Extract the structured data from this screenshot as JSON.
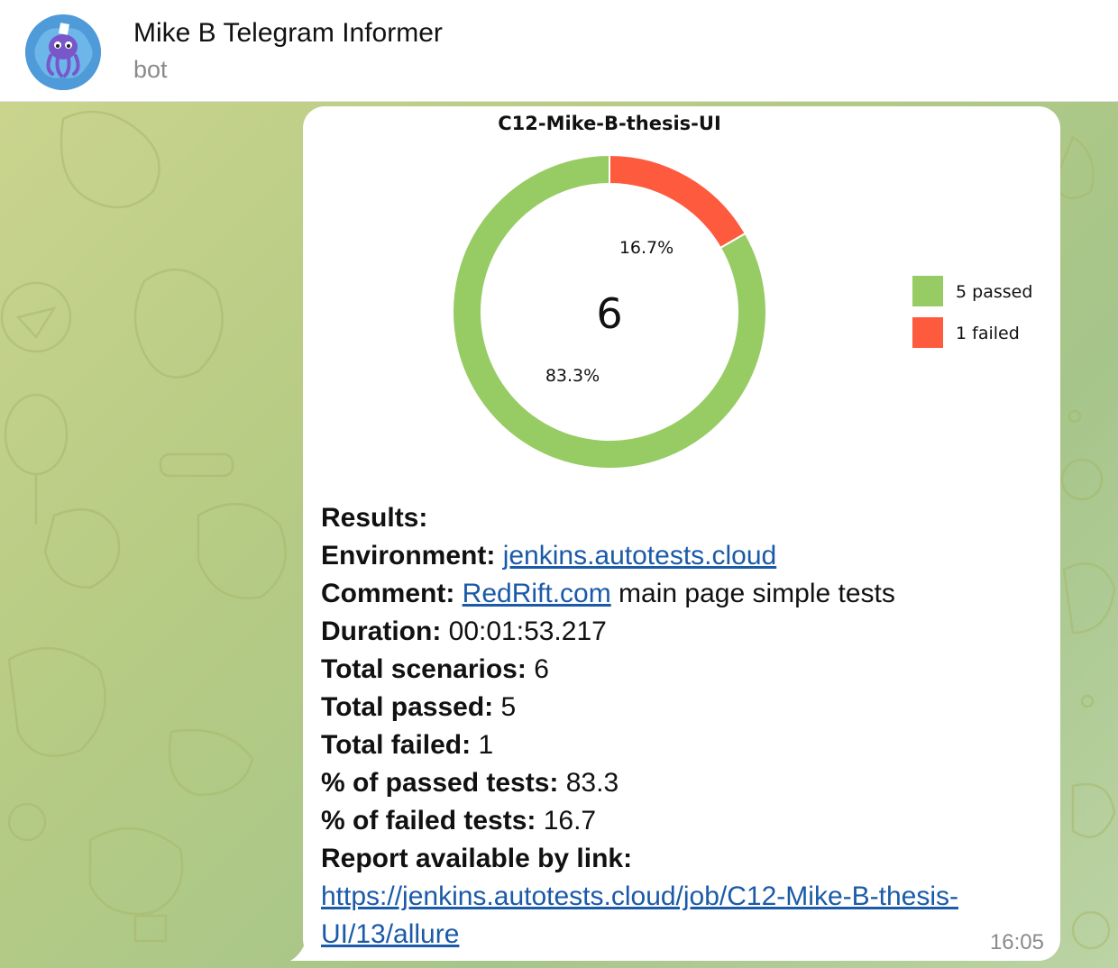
{
  "header": {
    "title": "Mike B Telegram Informer",
    "subtitle": "bot",
    "avatar_icon": "octopus-bot-icon"
  },
  "message": {
    "chart_data": {
      "type": "pie",
      "title": "C12-Mike-B-thesis-UI",
      "center_label": "6",
      "slices": [
        {
          "label": "5 passed",
          "value": 5,
          "percent_label": "83.3%",
          "color": "#97cc64"
        },
        {
          "label": "1 failed",
          "value": 1,
          "percent_label": "16.7%",
          "color": "#fd5a3e"
        }
      ],
      "legend_position": "right"
    },
    "results_label": "Results:",
    "environment_label": "Environment: ",
    "environment_link": "jenkins.autotests.cloud",
    "comment_label": "Comment: ",
    "comment_link": "RedRift.com",
    "comment_text": " main page simple tests",
    "duration_label": "Duration: ",
    "duration_value": "00:01:53.217",
    "total_scenarios_label": "Total scenarios: ",
    "total_scenarios_value": "6",
    "total_passed_label": "Total passed: ",
    "total_passed_value": "5",
    "total_failed_label": "Total failed: ",
    "total_failed_value": "1",
    "passed_pct_label": "% of passed tests: ",
    "passed_pct_value": "83.3",
    "failed_pct_label": "% of failed tests: ",
    "failed_pct_value": "16.7",
    "report_label": "Report available by link:",
    "report_url_line1": "https://jenkins.autotests.cloud/job/C12-Mike-B-thesis-",
    "report_url_line2": "UI/13/allure",
    "time": "16:05"
  }
}
